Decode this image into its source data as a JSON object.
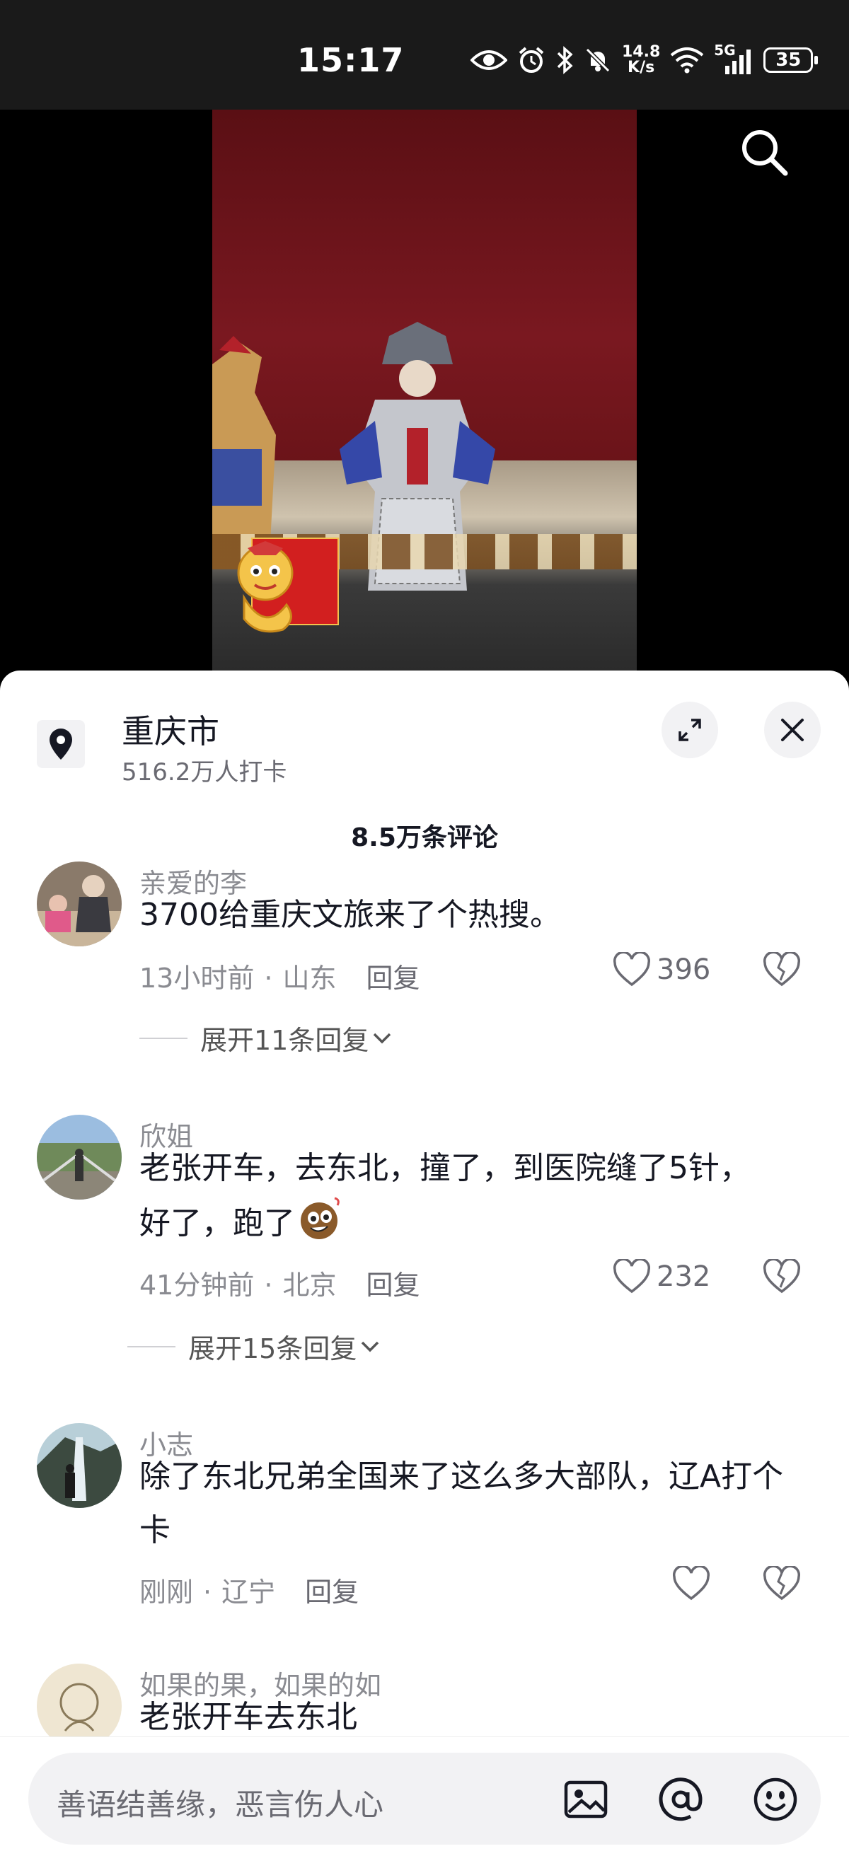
{
  "status_bar": {
    "time": "15:17",
    "net_speed_value": "14.8",
    "net_speed_unit": "K/s",
    "signal_label": "5G",
    "battery": "35"
  },
  "location": {
    "name": "重庆市",
    "checkins": "516.2万人打卡"
  },
  "comments_header": "8.5万条评论",
  "comments": [
    {
      "user": "亲爱的李",
      "text": "3700给重庆文旅来了个热搜。",
      "time": "13小时前",
      "region": "山东",
      "reply_label": "回复",
      "likes": "396",
      "expand_label": "展开11条回复"
    },
    {
      "user": "欣姐",
      "text": "老张开车，去东北，撞了，到医院缝了5针，好了，跑了",
      "time": "41分钟前",
      "region": "北京",
      "reply_label": "回复",
      "likes": "232",
      "expand_label": "展开15条回复"
    },
    {
      "user": "小志",
      "text": "除了东北兄弟全国来了这么多大部队，辽A打个卡",
      "time": "刚刚",
      "region": "辽宁",
      "reply_label": "回复",
      "likes": ""
    },
    {
      "user": "如果的果，如果的如",
      "text": "老张开车去东北"
    }
  ],
  "input": {
    "placeholder": "善语结善缘，恶言伤人心"
  },
  "icons": {
    "search": "search-icon",
    "location": "location-pin-icon",
    "expand": "expand-icon",
    "close": "close-icon",
    "like": "heart-icon",
    "dislike": "broken-heart-icon",
    "image": "image-icon",
    "mention": "at-icon",
    "emoji": "emoji-icon"
  },
  "colors": {
    "primary_text": "#161823",
    "secondary_text": "#8a8b91",
    "sheet_bg": "#ffffff",
    "status_bg": "#1a1a1a"
  }
}
